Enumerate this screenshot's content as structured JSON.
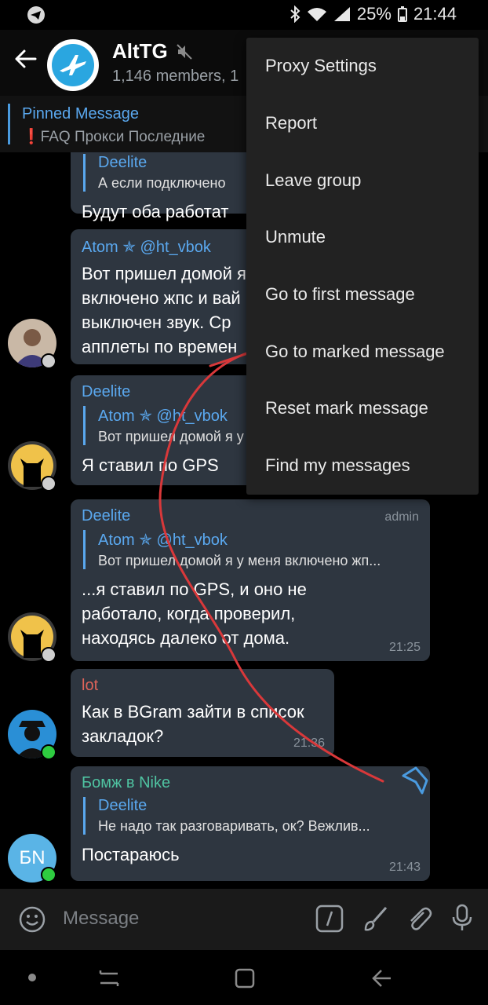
{
  "status_bar": {
    "battery": "25%",
    "time": "21:44"
  },
  "header": {
    "title": "AltTG",
    "subtitle": "1,146 members, 1"
  },
  "pinned": {
    "title": "Pinned Message",
    "text": "❗FAQ  Прокси  Последние"
  },
  "messages": [
    {
      "reply_name": "Deelite",
      "reply_text": "А если подключено",
      "text": "Будут оба работат"
    },
    {
      "sender": "Atom ✯ @ht_vbok",
      "lines": [
        "Вот пришел домой я у",
        "включено жпс и вай",
        "выключен звук. Ср",
        "апплеты по времен"
      ]
    },
    {
      "sender": "Deelite",
      "reply_name": "Atom ✯ @ht_vbok",
      "reply_text": "Вот пришел домой я у",
      "text": "Я ставил по GPS"
    },
    {
      "sender": "Deelite",
      "badge": "admin",
      "reply_name": "Atom ✯ @ht_vbok",
      "reply_text": "Вот пришел домой я у меня включено жп...",
      "lines": [
        "...я ставил по GPS, и оно не",
        "работало, когда проверил,",
        "находясь далеко от дома."
      ],
      "time": "21:25"
    },
    {
      "sender": "lot",
      "lines": [
        "Как в BGram зайти в список",
        "закладок?"
      ],
      "time": "21:36"
    },
    {
      "sender": "Бомж в Nike",
      "reply_name": "Deelite",
      "reply_text": "Не надо так разговаривать, ок? Вежлив...",
      "text": "Постараюсь",
      "time": "21:43"
    }
  ],
  "avatars": {
    "bn_initials": "БN"
  },
  "input": {
    "placeholder": "Message"
  },
  "menu": {
    "items": [
      "Proxy Settings",
      "Report",
      "Leave group",
      "Unmute",
      "Go to first message",
      "Go to marked message",
      "Reset mark message",
      "Find my messages"
    ]
  },
  "colors": {
    "accent": "#5aa8ef",
    "bubble": "#2e3640",
    "menu_bg": "#222222",
    "online": "#2ecc40",
    "arrow": "#d9383a",
    "lot_name": "#e0645a",
    "bomzh_name": "#4fc3a1"
  },
  "icons": {
    "status_left": "telegram-icon",
    "back": "back-arrow-icon",
    "muted": "muted-speaker-icon",
    "bookmark": "bookmark-icon",
    "emoji": "emoji-icon",
    "command": "slash-command-icon",
    "brush": "brush-icon",
    "attach": "paperclip-icon",
    "mic": "microphone-icon"
  }
}
